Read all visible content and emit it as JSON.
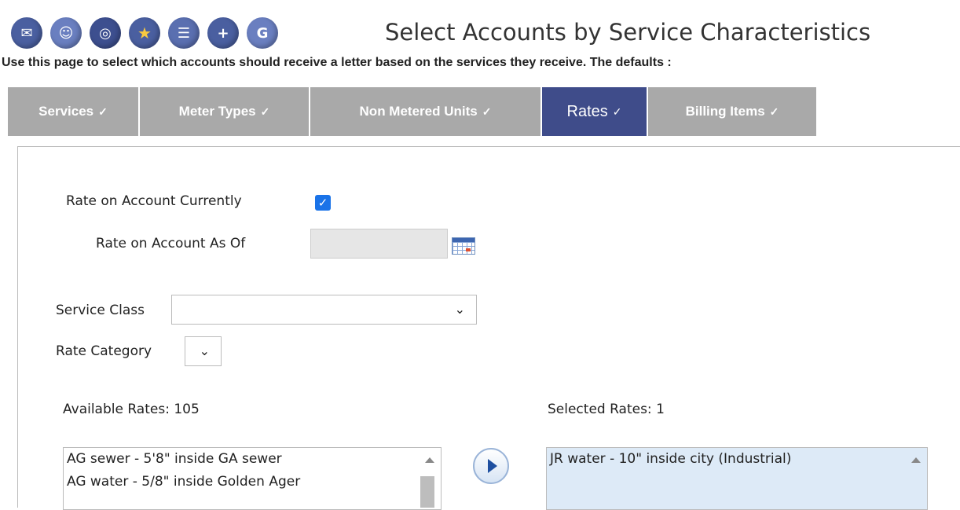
{
  "header": {
    "icons": [
      "mail-merge-icon",
      "people-icon",
      "disk-icon",
      "star-icon",
      "accounts-icon",
      "add-icon",
      "go-icon"
    ],
    "title": "Select Accounts by Service Characteristics",
    "description": "Use this page to select which accounts should receive a letter based on the services they receive. The defaults :"
  },
  "tabs": [
    {
      "label": "Services",
      "check": "✓"
    },
    {
      "label": "Meter Types",
      "check": "✓"
    },
    {
      "label": "Non Metered Units",
      "check": "✓"
    },
    {
      "label": "Rates",
      "check": "✓"
    },
    {
      "label": "Billing Items",
      "check": "✓"
    }
  ],
  "form": {
    "rate_current_label": "Rate on Account Currently",
    "rate_current_checked": true,
    "rate_asof_label": "Rate on Account As Of",
    "rate_asof_value": "",
    "service_class_label": "Service Class",
    "service_class_value": "",
    "rate_category_label": "Rate Category",
    "rate_category_value": ""
  },
  "available": {
    "label": "Available Rates: 105",
    "items": [
      "AG sewer - 5'8\" inside GA sewer",
      "AG water - 5/8\" inside Golden Ager"
    ]
  },
  "selected": {
    "label": "Selected Rates: 1",
    "items": [
      "JR water - 10\" inside city (Industrial)"
    ]
  },
  "colors": {
    "tab_inactive": "#a9a9a9",
    "tab_active": "#3f4c8a",
    "checkbox": "#1a73e8",
    "selected_list_bg": "#ddeaf7"
  }
}
